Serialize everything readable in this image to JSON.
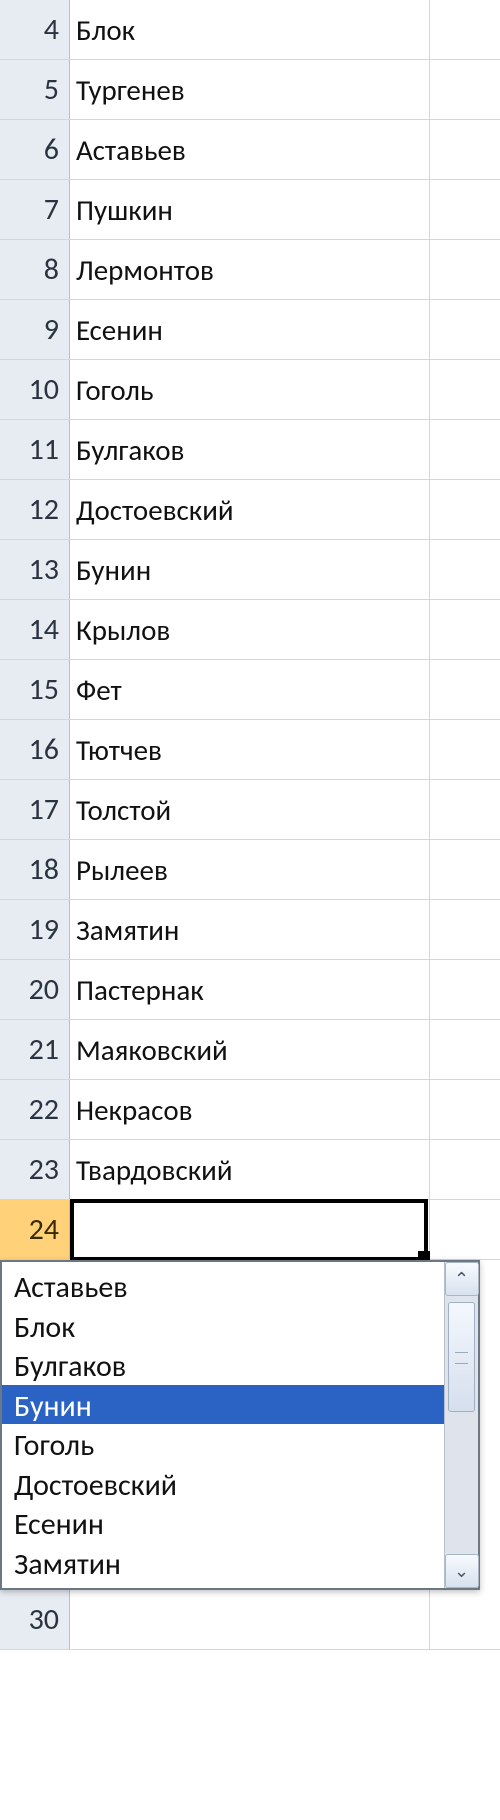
{
  "rows": [
    {
      "n": 4,
      "value": "Блок"
    },
    {
      "n": 5,
      "value": "Тургенев"
    },
    {
      "n": 6,
      "value": "Аставьев"
    },
    {
      "n": 7,
      "value": "Пушкин"
    },
    {
      "n": 8,
      "value": "Лермонтов"
    },
    {
      "n": 9,
      "value": "Есенин"
    },
    {
      "n": 10,
      "value": "Гоголь"
    },
    {
      "n": 11,
      "value": "Булгаков"
    },
    {
      "n": 12,
      "value": "Достоевский"
    },
    {
      "n": 13,
      "value": "Бунин"
    },
    {
      "n": 14,
      "value": "Крылов"
    },
    {
      "n": 15,
      "value": "Фет"
    },
    {
      "n": 16,
      "value": "Тютчев"
    },
    {
      "n": 17,
      "value": "Толстой"
    },
    {
      "n": 18,
      "value": "Рылеев"
    },
    {
      "n": 19,
      "value": "Замятин"
    },
    {
      "n": 20,
      "value": "Пастернак"
    },
    {
      "n": 21,
      "value": "Маяковский"
    },
    {
      "n": 22,
      "value": "Некрасов"
    },
    {
      "n": 23,
      "value": "Твардовский"
    }
  ],
  "active_row": {
    "n": 24,
    "value": ""
  },
  "trailing_rows": [
    {
      "n": 30,
      "value": ""
    }
  ],
  "autocomplete": {
    "items": [
      "Аставьев",
      "Блок",
      "Булгаков",
      "Бунин",
      "Гоголь",
      "Достоевский",
      "Есенин",
      "Замятин"
    ],
    "selected_index": 3
  },
  "icons": {
    "up": "⌃",
    "down": "⌄"
  }
}
